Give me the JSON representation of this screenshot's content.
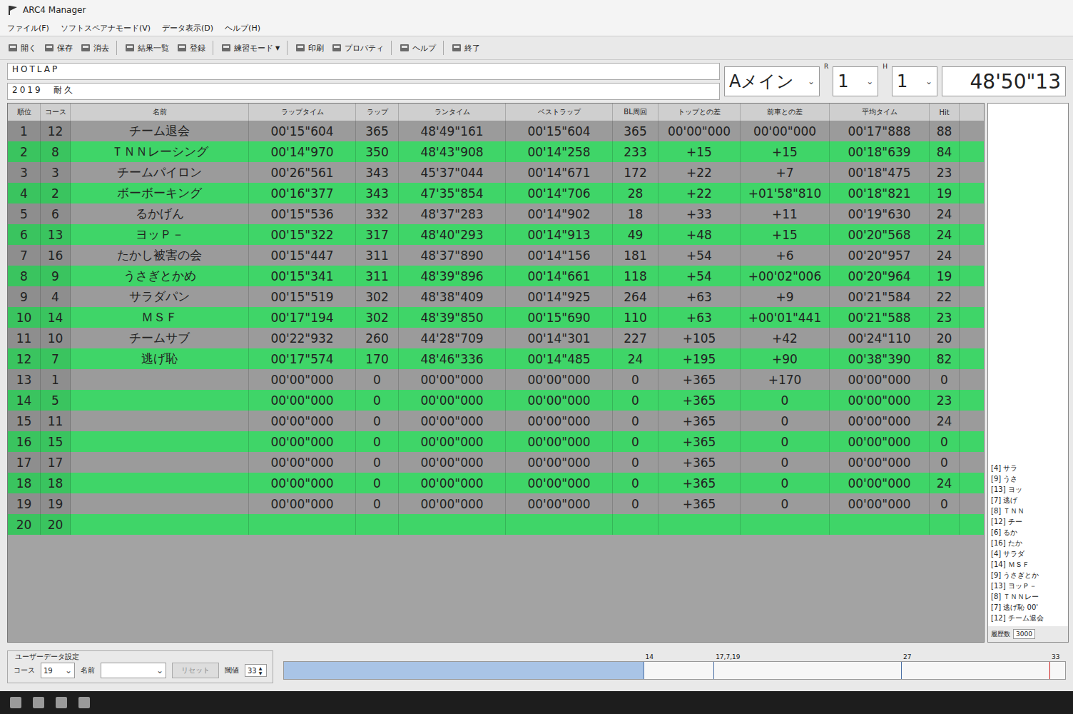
{
  "window": {
    "title": "ARC4 Manager"
  },
  "menu": [
    "ファイル(F)",
    "ソフトスペアナモード(V)",
    "データ表示(D)",
    "ヘルプ(H)"
  ],
  "toolbar": [
    {
      "label": "開く",
      "arrow": ""
    },
    {
      "label": "保存",
      "arrow": ""
    },
    {
      "label": "消去",
      "arrow": ""
    },
    {
      "label": "結果一覧",
      "arrow": ""
    },
    {
      "label": "登録",
      "arrow": ""
    },
    {
      "label": "練習モード",
      "arrow": "▼"
    },
    {
      "label": "印刷",
      "arrow": ""
    },
    {
      "label": "プロパティ",
      "arrow": ""
    },
    {
      "label": "ヘルプ",
      "arrow": ""
    },
    {
      "label": "終了",
      "arrow": ""
    }
  ],
  "fields": {
    "event": "HOTLAP",
    "race": "2019　耐久",
    "heat": "Aメイン",
    "r_label": "R",
    "r_value": "1",
    "h_label": "H",
    "h_value": "1",
    "clock": "48'50\"13",
    "arrow": "⌄"
  },
  "table": {
    "columns": [
      "順位",
      "コース",
      "名前",
      "ラップタイム",
      "ラップ",
      "ランタイム",
      "ベストラップ",
      "BL周回",
      "トップとの差",
      "前車との差",
      "平均タイム",
      "Hit"
    ],
    "rows": [
      [
        "1",
        "12",
        "チーム退会",
        "00'15\"604",
        "365",
        "48'49\"161",
        "00'15\"604",
        "365",
        "00'00\"000",
        "00'00\"000",
        "00'17\"888",
        "88"
      ],
      [
        "2",
        "8",
        "ＴＮＮレーシング",
        "00'14\"970",
        "350",
        "48'43\"908",
        "00'14\"258",
        "233",
        "+15",
        "+15",
        "00'18\"639",
        "84"
      ],
      [
        "3",
        "3",
        "チームパイロン",
        "00'26\"561",
        "343",
        "45'37\"044",
        "00'14\"671",
        "172",
        "+22",
        "+7",
        "00'18\"475",
        "23"
      ],
      [
        "4",
        "2",
        "ボーボーキング",
        "00'16\"377",
        "343",
        "47'35\"854",
        "00'14\"706",
        "28",
        "+22",
        "+01'58\"810",
        "00'18\"821",
        "19"
      ],
      [
        "5",
        "6",
        "るかげん",
        "00'15\"536",
        "332",
        "48'37\"283",
        "00'14\"902",
        "18",
        "+33",
        "+11",
        "00'19\"630",
        "24"
      ],
      [
        "6",
        "13",
        "ヨッＰ－",
        "00'15\"322",
        "317",
        "48'40\"293",
        "00'14\"913",
        "49",
        "+48",
        "+15",
        "00'20\"568",
        "24"
      ],
      [
        "7",
        "16",
        "たかし被害の会",
        "00'15\"447",
        "311",
        "48'37\"890",
        "00'14\"156",
        "181",
        "+54",
        "+6",
        "00'20\"957",
        "24"
      ],
      [
        "8",
        "9",
        "うさぎとかめ",
        "00'15\"341",
        "311",
        "48'39\"896",
        "00'14\"661",
        "118",
        "+54",
        "+00'02\"006",
        "00'20\"964",
        "19"
      ],
      [
        "9",
        "4",
        "サラダパン",
        "00'15\"519",
        "302",
        "48'38\"409",
        "00'14\"925",
        "264",
        "+63",
        "+9",
        "00'21\"584",
        "22"
      ],
      [
        "10",
        "14",
        "ＭＳＦ",
        "00'17\"194",
        "302",
        "48'39\"850",
        "00'15\"690",
        "110",
        "+63",
        "+00'01\"441",
        "00'21\"588",
        "23"
      ],
      [
        "11",
        "10",
        "チームサブ",
        "00'22\"932",
        "260",
        "44'28\"709",
        "00'14\"301",
        "227",
        "+105",
        "+42",
        "00'24\"110",
        "20"
      ],
      [
        "12",
        "7",
        "逃げ恥",
        "00'17\"574",
        "170",
        "48'46\"336",
        "00'14\"485",
        "24",
        "+195",
        "+90",
        "00'38\"390",
        "82"
      ],
      [
        "13",
        "1",
        "",
        "00'00\"000",
        "0",
        "00'00\"000",
        "00'00\"000",
        "0",
        "+365",
        "+170",
        "00'00\"000",
        "0"
      ],
      [
        "14",
        "5",
        "",
        "00'00\"000",
        "0",
        "00'00\"000",
        "00'00\"000",
        "0",
        "+365",
        "0",
        "00'00\"000",
        "23"
      ],
      [
        "15",
        "11",
        "",
        "00'00\"000",
        "0",
        "00'00\"000",
        "00'00\"000",
        "0",
        "+365",
        "0",
        "00'00\"000",
        "24"
      ],
      [
        "16",
        "15",
        "",
        "00'00\"000",
        "0",
        "00'00\"000",
        "00'00\"000",
        "0",
        "+365",
        "0",
        "00'00\"000",
        "0"
      ],
      [
        "17",
        "17",
        "",
        "00'00\"000",
        "0",
        "00'00\"000",
        "00'00\"000",
        "0",
        "+365",
        "0",
        "00'00\"000",
        "0"
      ],
      [
        "18",
        "18",
        "",
        "00'00\"000",
        "0",
        "00'00\"000",
        "00'00\"000",
        "0",
        "+365",
        "0",
        "00'00\"000",
        "24"
      ],
      [
        "19",
        "19",
        "",
        "00'00\"000",
        "0",
        "00'00\"000",
        "00'00\"000",
        "0",
        "+365",
        "0",
        "00'00\"000",
        "0"
      ],
      [
        "20",
        "20",
        "",
        "",
        "",
        "",
        "",
        "",
        "",
        "",
        "",
        ""
      ]
    ]
  },
  "log": {
    "entries": [
      "[4] サラ",
      "[9] うさ",
      "[13] ヨッ",
      "[7] 逃げ",
      "[8] ＴＮＮ",
      "[12] チー",
      "[6] るか",
      "[16] たか",
      "[4] サラダ",
      "[14] ＭＳＦ",
      "[9] うさぎとか",
      "[13] ヨッＰ－",
      "[8] ＴＮＮレー",
      "[7] 逃げ恥 00'",
      "[12] チーム退会"
    ],
    "count_label": "履歴数",
    "count": "3000"
  },
  "user_data": {
    "title": "ユーザーデータ設定",
    "course_label": "コース",
    "course": "19",
    "name_label": "名前",
    "name": "",
    "reset": {
      "label": "リセット",
      "disabled": true
    },
    "threshold_label": "閾値",
    "threshold": "33",
    "spin": "▲▼",
    "meter": {
      "level": 0.46,
      "markers": [
        {
          "label": "14",
          "level": 0.46,
          "color": "#4a6fa5"
        },
        {
          "label": "17,7,19",
          "level": 0.55,
          "color": "#4a6fa5"
        },
        {
          "label": "27",
          "level": 0.79,
          "color": "#4a6fa5"
        },
        {
          "label": "33",
          "level": 0.98,
          "color": "#d02020"
        }
      ]
    }
  }
}
